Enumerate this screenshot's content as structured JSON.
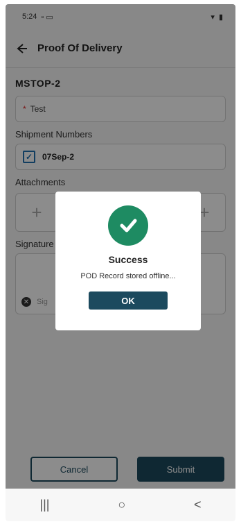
{
  "status_bar": {
    "time": "5:24",
    "indicators": [
      "signal-icon",
      "battery-icon"
    ]
  },
  "app": {
    "title": "Proof Of Delivery"
  },
  "form": {
    "stop_id": "MSTOP-2",
    "required_marker": "*",
    "receiver_value": "Test",
    "shipment_label": "Shipment Numbers",
    "shipment_checked": true,
    "shipment_value": "07Sep-2",
    "attachments_label": "Attachments",
    "signature_label": "Signature",
    "clear_signature_text": "Sig"
  },
  "buttons": {
    "cancel": "Cancel",
    "submit": "Submit"
  },
  "dialog": {
    "title": "Success",
    "message": "POD Record stored offline...",
    "ok_label": "OK",
    "icon": "checkmark-circle-icon",
    "icon_color": "#1e8b62"
  },
  "nav": {
    "recent": "|||",
    "home": "○",
    "back": "<"
  },
  "colors": {
    "primary": "#1c4a5e",
    "success": "#1e8b62",
    "overlay": "rgba(0,0,0,0.45)"
  }
}
